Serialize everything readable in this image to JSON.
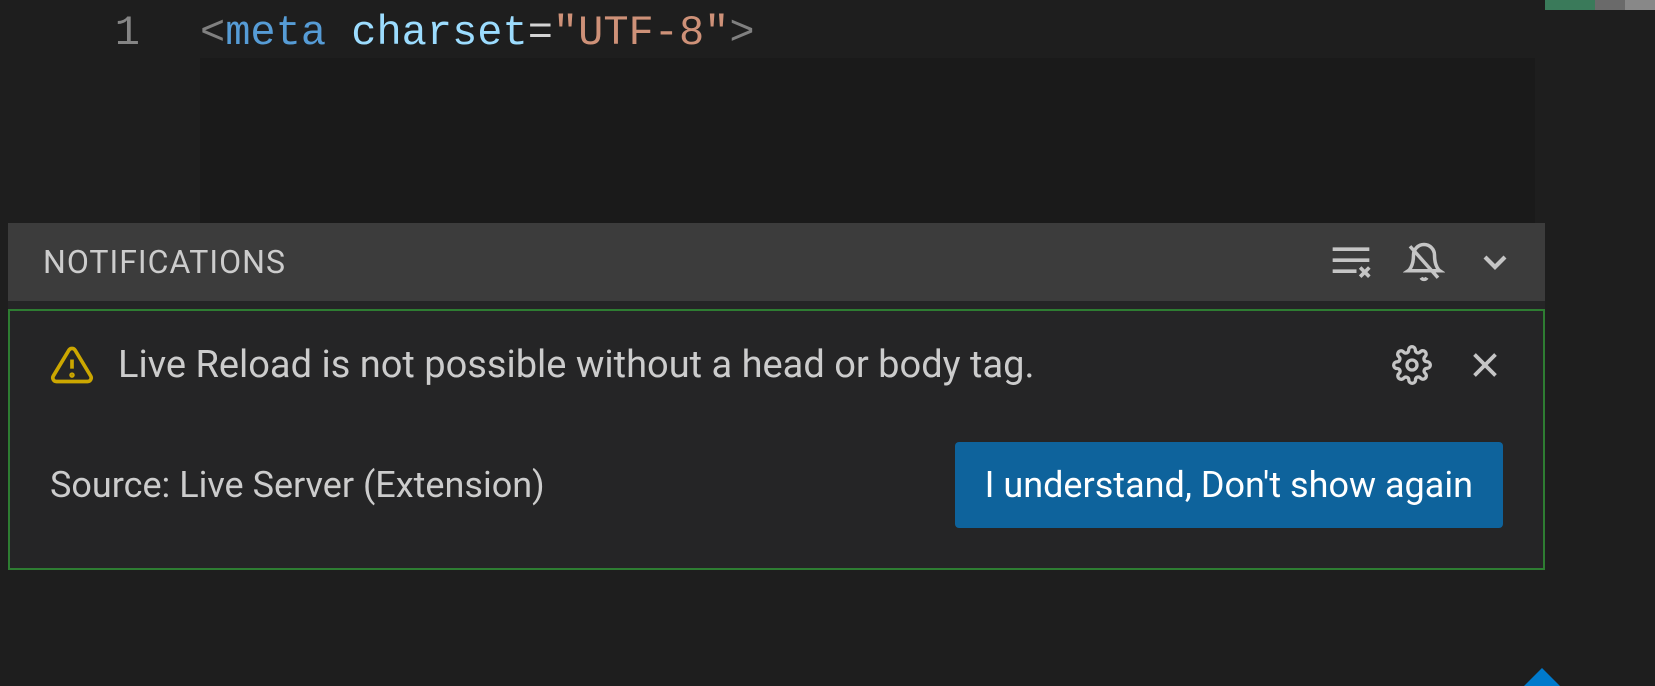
{
  "editor": {
    "line_number": "1",
    "code": {
      "open_bracket": "<",
      "tag": "meta",
      "attr": "charset",
      "eq": "=",
      "string": "\"UTF-8\"",
      "close_bracket": ">"
    }
  },
  "notifications": {
    "title": "NOTIFICATIONS",
    "item": {
      "message": "Live Reload is not possible without a head or body tag.",
      "source": "Source: Live Server (Extension)",
      "button_label": "I understand, Don't show again"
    },
    "colors": {
      "border": "#2e7d32",
      "button_bg": "#0e639c",
      "warning": "#cca700"
    }
  }
}
